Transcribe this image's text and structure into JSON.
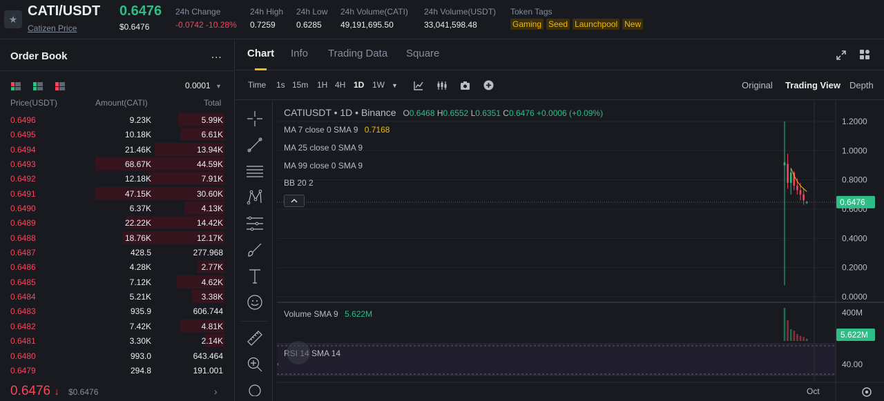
{
  "header": {
    "pair": "CATI/USDT",
    "pair_subtitle": "Catizen Price",
    "last_price": "0.6476",
    "last_price_usd": "$0.6476",
    "stats": [
      {
        "label": "24h Change",
        "value": "-0.0742 -10.28%",
        "negative": true
      },
      {
        "label": "24h High",
        "value": "0.7259"
      },
      {
        "label": "24h Low",
        "value": "0.6285"
      },
      {
        "label": "24h Volume(CATI)",
        "value": "49,191,695.50"
      },
      {
        "label": "24h Volume(USDT)",
        "value": "33,041,598.48"
      }
    ],
    "tags_label": "Token Tags",
    "tags": [
      "Gaming",
      "Seed",
      "Launchpool",
      "New"
    ]
  },
  "order_book": {
    "title": "Order Book",
    "more_label": "...",
    "tick_size": "0.0001",
    "col_price": "Price(USDT)",
    "col_amount": "Amount(CATI)",
    "col_total": "Total",
    "rows": [
      {
        "price": "0.6496",
        "amount": "9.23K",
        "total": "5.99K",
        "depth": 0.36
      },
      {
        "price": "0.6495",
        "amount": "10.18K",
        "total": "6.61K",
        "depth": 0.34
      },
      {
        "price": "0.6494",
        "amount": "21.46K",
        "total": "13.94K",
        "depth": 0.54
      },
      {
        "price": "0.6493",
        "amount": "68.67K",
        "total": "44.59K",
        "depth": 1.0
      },
      {
        "price": "0.6492",
        "amount": "12.18K",
        "total": "7.91K",
        "depth": 0.59
      },
      {
        "price": "0.6491",
        "amount": "47.15K",
        "total": "30.60K",
        "depth": 1.0
      },
      {
        "price": "0.6490",
        "amount": "6.37K",
        "total": "4.13K",
        "depth": 0.31
      },
      {
        "price": "0.6489",
        "amount": "22.22K",
        "total": "14.42K",
        "depth": 0.76
      },
      {
        "price": "0.6488",
        "amount": "18.76K",
        "total": "12.17K",
        "depth": 0.79
      },
      {
        "price": "0.6487",
        "amount": "428.5",
        "total": "277.968",
        "depth": 0.0
      },
      {
        "price": "0.6486",
        "amount": "4.28K",
        "total": "2.77K",
        "depth": 0.21
      },
      {
        "price": "0.6485",
        "amount": "7.12K",
        "total": "4.62K",
        "depth": 0.37
      },
      {
        "price": "0.6484",
        "amount": "5.21K",
        "total": "3.38K",
        "depth": 0.25
      },
      {
        "price": "0.6483",
        "amount": "935.9",
        "total": "606.744",
        "depth": 0.0
      },
      {
        "price": "0.6482",
        "amount": "7.42K",
        "total": "4.81K",
        "depth": 0.34
      },
      {
        "price": "0.6481",
        "amount": "3.30K",
        "total": "2.14K",
        "depth": 0.15
      },
      {
        "price": "0.6480",
        "amount": "993.0",
        "total": "643.464",
        "depth": 0.0
      },
      {
        "price": "0.6479",
        "amount": "294.8",
        "total": "191.001",
        "depth": 0.0
      }
    ],
    "last_price": "0.6476",
    "last_arrow": "↓",
    "last_price_usd": "$0.6476",
    "more_arrow": "›"
  },
  "chart_panel": {
    "tabs": [
      "Chart",
      "Info",
      "Trading Data",
      "Square"
    ],
    "intervals": [
      "Time",
      "1s",
      "15m",
      "1H",
      "4H",
      "1D",
      "1W"
    ],
    "active_interval": "1D",
    "views": [
      "Original",
      "Trading View",
      "Depth"
    ],
    "active_view": "Trading View"
  },
  "chart_data": {
    "type": "candlestick",
    "symbol_line": "CATIUSDT • 1D • Binance",
    "ohlc": {
      "o_label": "O",
      "o": "0.6468",
      "h_label": "H",
      "h": "0.6552",
      "l_label": "L",
      "l": "0.6351",
      "c_label": "C",
      "c": "0.6476",
      "change": "+0.0006 (+0.09%)"
    },
    "indicators": [
      {
        "label": "MA 7 close 0 SMA 9",
        "value": "0.7168"
      },
      {
        "label": "MA 25 close 0 SMA 9",
        "value": ""
      },
      {
        "label": "MA 99 close 0 SMA 9",
        "value": ""
      },
      {
        "label": "BB 20 2",
        "value": ""
      }
    ],
    "price_axis": [
      "1.2000",
      "1.0000",
      "0.8000",
      "0.6000",
      "0.4000",
      "0.2000",
      "0.0000"
    ],
    "price_ticks": [
      1.2,
      1.0,
      0.8,
      0.6,
      0.4,
      0.2,
      0.0
    ],
    "ylim": [
      0,
      1.2
    ],
    "current_price": "0.6476",
    "current_price_value": 0.6476,
    "candles": [
      {
        "o": 0.9,
        "h": 1.2,
        "l": 0.08,
        "c": 0.92
      },
      {
        "o": 0.91,
        "h": 0.98,
        "l": 0.74,
        "c": 0.78
      },
      {
        "o": 0.78,
        "h": 0.88,
        "l": 0.7,
        "c": 0.85
      },
      {
        "o": 0.85,
        "h": 0.86,
        "l": 0.73,
        "c": 0.76
      },
      {
        "o": 0.76,
        "h": 0.81,
        "l": 0.7,
        "c": 0.73
      },
      {
        "o": 0.73,
        "h": 0.78,
        "l": 0.66,
        "c": 0.7
      },
      {
        "o": 0.7,
        "h": 0.74,
        "l": 0.63,
        "c": 0.66
      },
      {
        "o": 0.6468,
        "h": 0.6552,
        "l": 0.6351,
        "c": 0.6476
      }
    ],
    "ma7": [
      null,
      null,
      0.88,
      0.83,
      0.79,
      0.76,
      0.74,
      0.72
    ],
    "volume_label": "Volume SMA 9",
    "volume_value": "5.622M",
    "volume_axis": [
      "400M"
    ],
    "volumes_m": [
      450,
      280,
      160,
      140,
      95,
      70,
      55,
      30
    ],
    "rsi_label": "RSI 14 SMA 14",
    "rsi_axis": [
      "40.00"
    ],
    "x_label": "Oct"
  }
}
